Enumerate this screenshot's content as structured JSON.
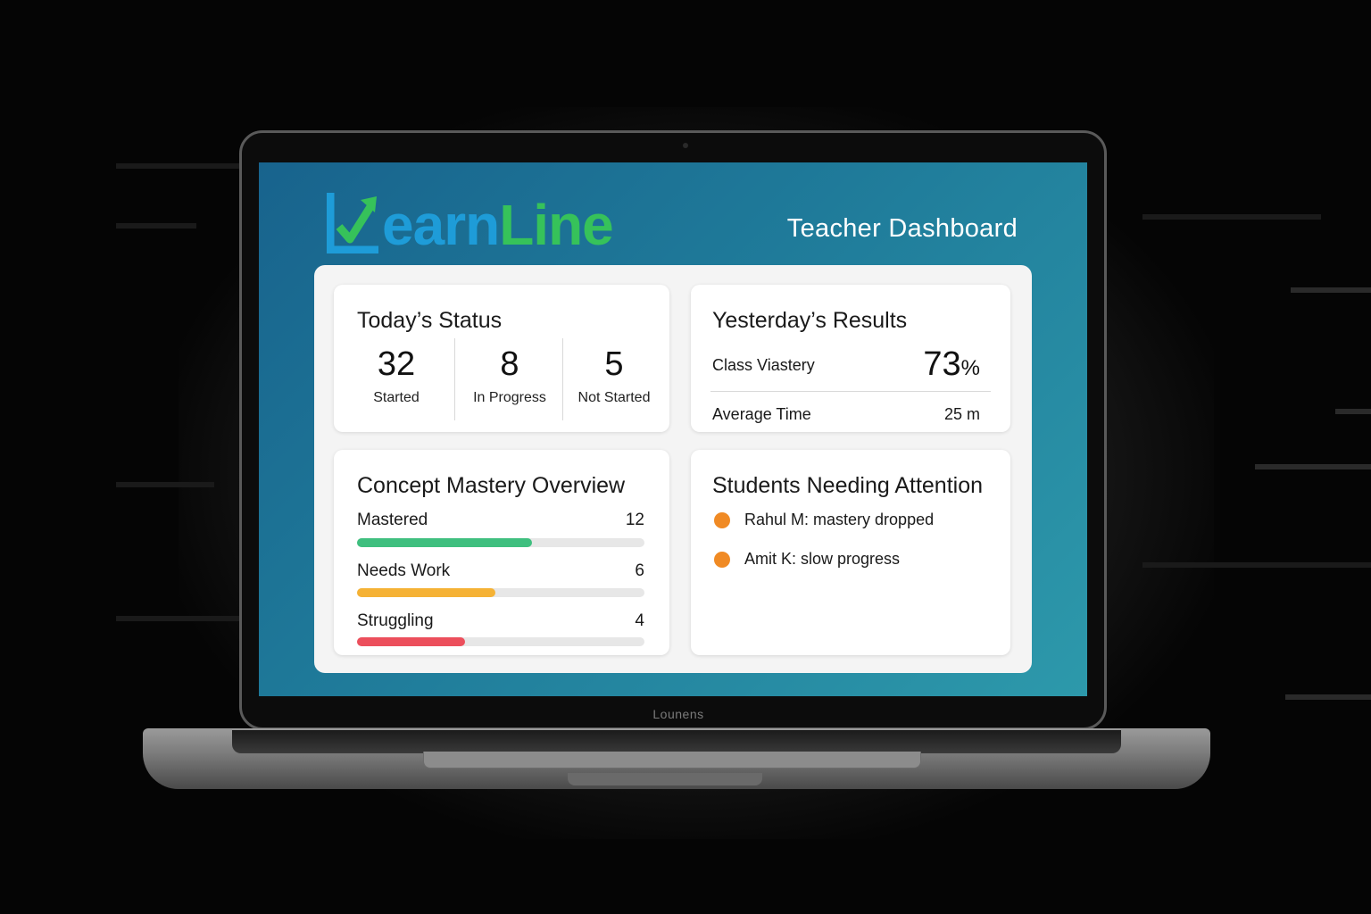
{
  "app": {
    "logo_text_earn": "earn",
    "logo_text_line": "Line",
    "page_title": "Teacher Dashboard",
    "device_brand": "Lounens"
  },
  "today_status": {
    "title": "Today’s Status",
    "items": [
      {
        "value": "32",
        "label": "Started"
      },
      {
        "value": "8",
        "label": "In Progress"
      },
      {
        "value": "5",
        "label": "Not Started"
      }
    ]
  },
  "yesterday_results": {
    "title": "Yesterday’s Results",
    "class_mastery_label": "Class Viastery",
    "class_mastery_value": "73",
    "class_mastery_unit": "%",
    "average_time_label": "Average Time",
    "average_time_value": "25 m"
  },
  "concept_mastery": {
    "title": "Concept Mastery Overview",
    "rows": [
      {
        "label": "Mastered",
        "count": "12",
        "fraction": 0.61,
        "color": "#3fbf7f"
      },
      {
        "label": "Needs Work",
        "count": "6",
        "fraction": 0.48,
        "color": "#f5b235"
      },
      {
        "label": "Struggling",
        "count": "4",
        "fraction": 0.375,
        "color": "#ec4f5c"
      }
    ]
  },
  "attention": {
    "title": "Students Needing Attention",
    "items": [
      {
        "text": "Rahul M: mastery dropped",
        "status_color": "#f08a24"
      },
      {
        "text": "Amit K: slow progress",
        "status_color": "#f08a24"
      }
    ]
  },
  "colors": {
    "logo_blue": "#1e9cd8",
    "logo_green": "#36c25a",
    "screen_bg_start": "#18638d",
    "screen_bg_end": "#2d99ab"
  },
  "icons": {
    "logo_mark": "chart-arrow-check-icon",
    "attention_bullet": "orange-dot-icon"
  }
}
